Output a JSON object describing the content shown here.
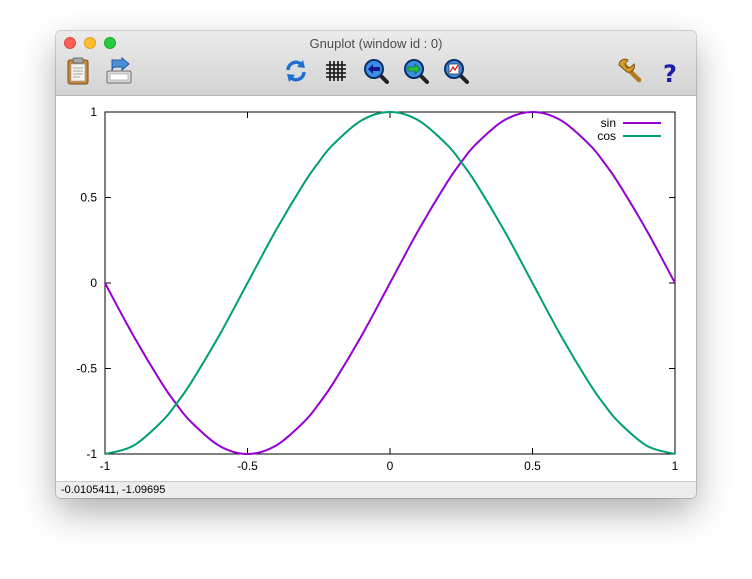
{
  "window": {
    "title": "Gnuplot (window id : 0)"
  },
  "toolbar": {
    "buttons": [
      {
        "id": "copy",
        "icon": "clipboard-icon"
      },
      {
        "id": "export",
        "icon": "export-icon"
      },
      {
        "id": "replot",
        "icon": "replot-icon"
      },
      {
        "id": "grid",
        "icon": "grid-icon"
      },
      {
        "id": "zoom-previous",
        "icon": "zoom-previous-icon"
      },
      {
        "id": "zoom-next",
        "icon": "zoom-next-icon"
      },
      {
        "id": "unzoom",
        "icon": "unzoom-icon"
      },
      {
        "id": "config",
        "icon": "wrench-icon"
      },
      {
        "id": "help",
        "icon": "help-icon"
      }
    ]
  },
  "status": {
    "coords": "-0.0105411, -1.09695"
  },
  "chart_data": {
    "type": "line",
    "xlim": [
      -1,
      1
    ],
    "ylim": [
      -1,
      1
    ],
    "xticks": [
      "-1",
      "-0.5",
      "0",
      "0.5",
      "1"
    ],
    "yticks": [
      "1",
      "0.5",
      "0",
      "-0.5",
      "-1"
    ],
    "grid": false,
    "legend": "top-right",
    "x": [
      -1,
      -0.9,
      -0.8,
      -0.75,
      -0.7,
      -0.6,
      -0.5,
      -0.4,
      -0.3,
      -0.25,
      -0.2,
      -0.1,
      0,
      0.1,
      0.2,
      0.25,
      0.3,
      0.4,
      0.5,
      0.6,
      0.7,
      0.75,
      0.8,
      0.9,
      1
    ],
    "series": [
      {
        "name": "sin",
        "color": "#9400d3",
        "values": [
          0,
          -0.309,
          -0.588,
          -0.707,
          -0.809,
          -0.951,
          -1,
          -0.951,
          -0.809,
          -0.707,
          -0.588,
          -0.309,
          0,
          0.309,
          0.588,
          0.707,
          0.809,
          0.951,
          1,
          0.951,
          0.809,
          0.707,
          0.588,
          0.309,
          0
        ]
      },
      {
        "name": "cos",
        "color": "#009e73",
        "values": [
          -1,
          -0.951,
          -0.809,
          -0.707,
          -0.588,
          -0.309,
          0,
          0.309,
          0.588,
          0.707,
          0.809,
          0.951,
          1,
          0.951,
          0.809,
          0.707,
          0.588,
          0.309,
          0,
          -0.309,
          -0.588,
          -0.707,
          -0.809,
          -0.951,
          -1
        ]
      }
    ]
  }
}
